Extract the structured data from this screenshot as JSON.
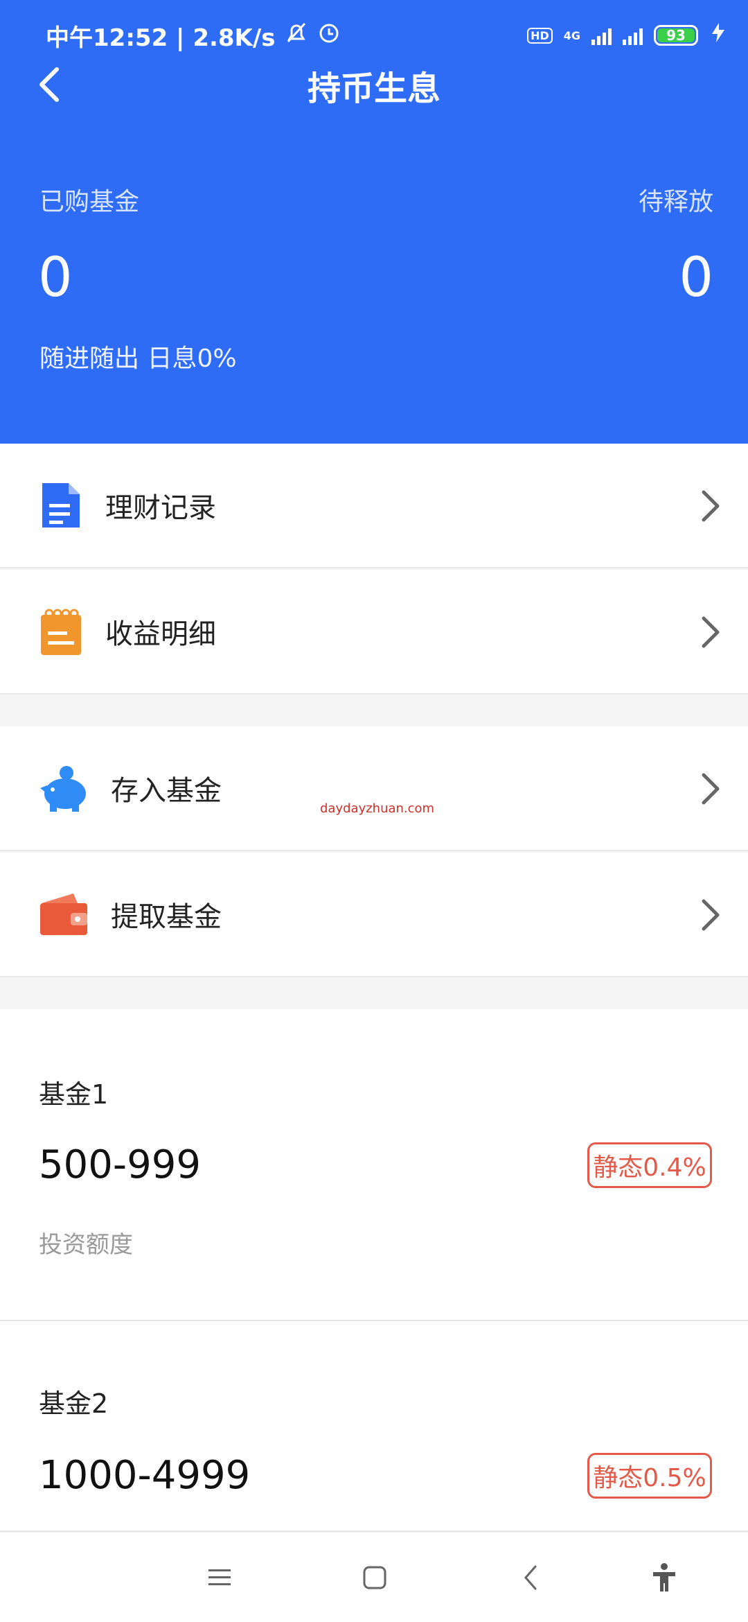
{
  "status_bar": {
    "time_speed": "中午12:52 | 2.8K/s",
    "hd_label": "HD",
    "network": "4G",
    "battery": "93",
    "icons": [
      "bell-off-icon",
      "alarm-icon",
      "signal-icon",
      "charging-icon"
    ]
  },
  "header": {
    "title": "持币生息",
    "purchased_label": "已购基金",
    "pending_label": "待释放",
    "purchased_value": "0",
    "pending_value": "0",
    "rate_text": "随进随出 日息0%",
    "background_color": "#2f6cf6"
  },
  "menu": [
    {
      "label": "理财记录",
      "icon": "document-icon",
      "color": "#2f6cf6"
    },
    {
      "label": "收益明细",
      "icon": "notepad-icon",
      "color": "#f0962c"
    },
    {
      "label": "存入基金",
      "icon": "piggy-bank-icon",
      "color": "#2f8cf6"
    },
    {
      "label": "提取基金",
      "icon": "wallet-icon",
      "color": "#e85a3a"
    }
  ],
  "watermark": "daydayzhuan.com",
  "funds": [
    {
      "name": "基金1",
      "range": "500-999",
      "badge": "静态0.4%",
      "sub_label": "投资额度"
    },
    {
      "name": "基金2",
      "range": "1000-4999",
      "badge": "静态0.5%"
    }
  ],
  "nav": [
    "menu-icon",
    "home-icon",
    "back-icon",
    "accessibility-icon"
  ]
}
